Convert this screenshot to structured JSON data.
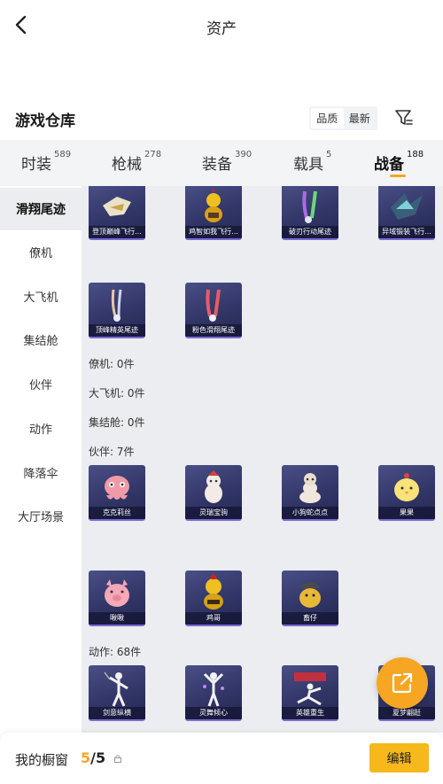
{
  "header": {
    "title": "资产"
  },
  "warehouse": {
    "title": "游戏仓库",
    "sort_options": [
      "品质",
      "最新"
    ],
    "sort_selected": "品质"
  },
  "categories": [
    {
      "label": "时装",
      "count": "589"
    },
    {
      "label": "枪械",
      "count": "278"
    },
    {
      "label": "装备",
      "count": "390"
    },
    {
      "label": "载具",
      "count": "5"
    },
    {
      "label": "战备",
      "count": "188"
    }
  ],
  "active_category": "战备",
  "sidebar": {
    "items": [
      "滑翔尾迹",
      "僚机",
      "大飞机",
      "集结舱",
      "伙伴",
      "动作",
      "降落伞",
      "大厅场景"
    ],
    "active": "滑翔尾迹"
  },
  "sections": {
    "glide_items": [
      "登顶巅峰飞行...",
      "鸡智如我飞行...",
      "破刃行动尾迹",
      "异域锻装飞行...",
      "顶峰精英尾迹",
      "粉色滑翔尾迹"
    ],
    "wingman_label": "僚机: 0件",
    "bigplane_label": "大飞机: 0件",
    "pod_label": "集结舱: 0件",
    "partner_label": "伙伴: 7件",
    "partner_items": [
      "克克莉丝",
      "灵瑞宝驹",
      "小狗蛇点点",
      "果果",
      "啾啾",
      "鸡哥",
      "畜仔"
    ],
    "action_label": "动作: 68件",
    "action_items": [
      "剑意纵横",
      "灵舞倾心",
      "英雄重生",
      "夏梦翩跹"
    ]
  },
  "bottom": {
    "label": "我的橱窗",
    "current": "5",
    "separator": "/",
    "total": "5",
    "edit_label": "编辑"
  },
  "colors": {
    "accent": "#f5a623",
    "card_bg": "#34386a",
    "content_bg": "#ebedf1"
  }
}
